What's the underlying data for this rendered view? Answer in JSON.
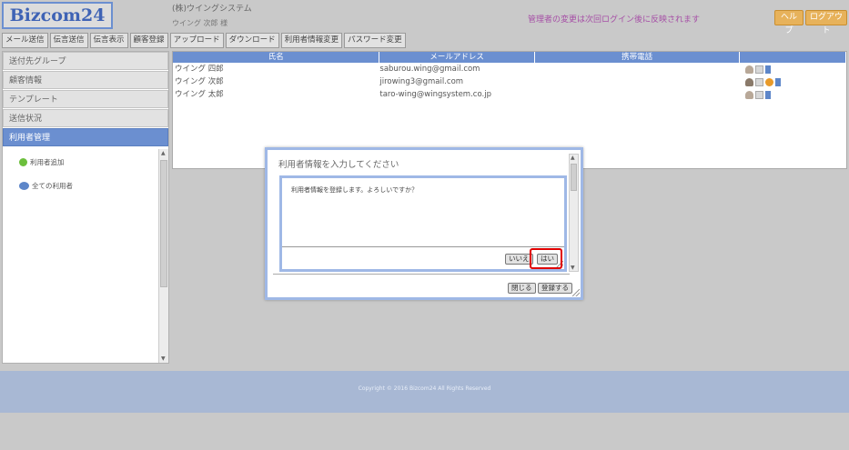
{
  "header": {
    "logo": "Bizcom24",
    "company": "(株)ウイングシステム",
    "user": "ウイング 次郎 様",
    "notice": "管理者の変更は次回ログイン後に反映されます",
    "help_label": "ヘルプ",
    "logout_label": "ログアウト"
  },
  "toolbar": [
    "メール送信",
    "伝言送信",
    "伝言表示",
    "顧客登録",
    "アップロード",
    "ダウンロード",
    "利用者情報変更",
    "パスワード変更"
  ],
  "sidebar": {
    "items": [
      "送付先グループ",
      "顧客情報",
      "テンプレート",
      "送信状況",
      "利用者管理"
    ],
    "sub_items": [
      "利用者追加",
      "全ての利用者"
    ]
  },
  "table": {
    "headers": [
      "氏名",
      "メールアドレス",
      "携帯電話",
      ""
    ],
    "rows": [
      {
        "name": "ウイング 四郎",
        "email": "saburou.wing@gmail.com",
        "phone": ""
      },
      {
        "name": "ウイング 次郎",
        "email": "jirowing3@gmail.com",
        "phone": ""
      },
      {
        "name": "ウイング 太郎",
        "email": "taro-wing@wingsystem.co.jp",
        "phone": ""
      }
    ]
  },
  "modal": {
    "title": "利用者情報を入力してください",
    "close_label": "閉じる",
    "register_label": "登録する"
  },
  "confirm": {
    "message": "利用者情報を登録します。よろしいですか？",
    "no_label": "いいえ",
    "yes_label": "はい"
  },
  "footer": {
    "copyright": "Copyright © 2016 Bizcom24 All Rights Reserved"
  },
  "colors": {
    "accent": "#6b8fd0",
    "header_button": "#e7b25b",
    "notice": "#a64fa6",
    "highlight": "#e00000"
  }
}
